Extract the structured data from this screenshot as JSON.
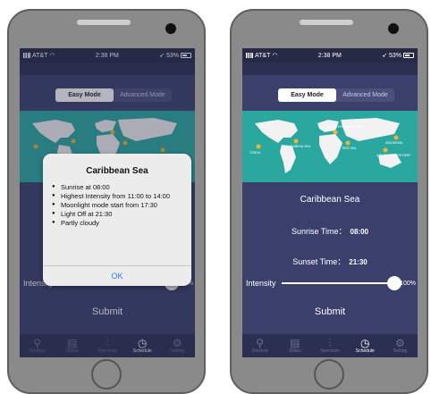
{
  "status": {
    "carrier": "AT&T",
    "time": "2:38 PM",
    "battery": "53%"
  },
  "modes": {
    "easy": "Easy Mode",
    "advanced": "Advanced Mode"
  },
  "map": {
    "labels": [
      "TONGA",
      "CARIBBEAN SEA",
      "MEDITERRANEAN SEA",
      "RED SEA",
      "GREAT BARRIER REEF",
      "INDONESIA"
    ]
  },
  "popup": {
    "title": "Caribbean Sea",
    "items": [
      "Sunrise at 08:00",
      "Highest Intensity from 11:00 to 14:00",
      "Moonlight mode start from 17:30",
      "Light Off at 21:30",
      "Partly cloudy"
    ],
    "ok": "OK"
  },
  "main": {
    "region": "Caribbean Sea",
    "sunrise_label": "Sunrise Time：",
    "sunrise_value": "08:00",
    "sunset_label": "Sunset Time：",
    "sunset_value": "21:30",
    "intensity_label": "Intensity",
    "intensity_value": "100%",
    "intensity_level": 1.0,
    "submit": "Submit"
  },
  "tabs": [
    "Devices",
    "Status",
    "Spectrum",
    "Schedule",
    "Setting"
  ],
  "active_tab": "Schedule",
  "colors": {
    "screen_bg": "#3a3f6c",
    "map_teal": "#2aa8a0",
    "accent_link": "#2f7cf6"
  }
}
